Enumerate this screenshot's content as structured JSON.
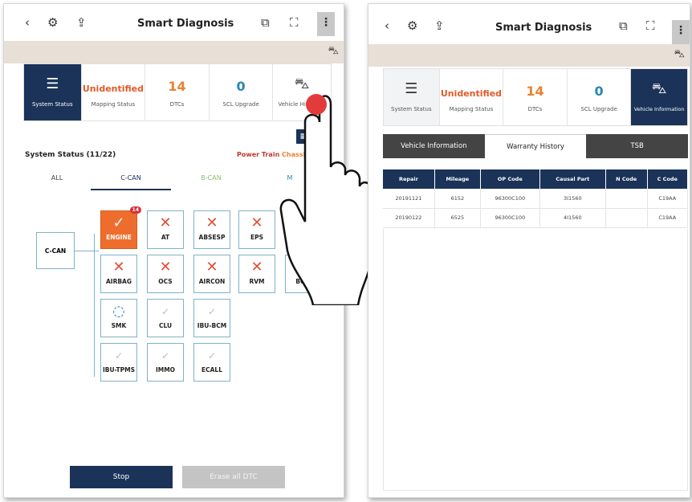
{
  "app": {
    "title": "Smart Diagnosis"
  },
  "status_tiles": {
    "system_status": "System Status",
    "mapping_value": "Unidentified",
    "mapping_label": "Mapping Status",
    "dtc_value": "14",
    "dtc_label": "DTCs",
    "scl_value": "0",
    "scl_label": "SCL Upgrade",
    "vehicle_label_left": "Vehicle Hi",
    "vehicle_label_right": "Vehicle Information"
  },
  "system_section": {
    "title": "System Status (11/22)",
    "filter_power": "Power Train",
    "filter_chassis": "Chassis"
  },
  "bus_tabs": [
    "ALL",
    "C-CAN",
    "B-CAN",
    "M"
  ],
  "bus_root": "C-CAN",
  "modules": [
    {
      "name": "ENGINE",
      "state": "active",
      "badge": "14"
    },
    {
      "name": "AT",
      "state": "error"
    },
    {
      "name": "ABSESP",
      "state": "error"
    },
    {
      "name": "EPS",
      "state": "error"
    },
    {
      "name": "AIRBAG",
      "state": "error"
    },
    {
      "name": "OCS",
      "state": "error"
    },
    {
      "name": "AIRCON",
      "state": "error"
    },
    {
      "name": "RVM",
      "state": "error"
    },
    {
      "name": "BCW",
      "state": "error"
    },
    {
      "name": "SMK",
      "state": "loading"
    },
    {
      "name": "CLU",
      "state": "done"
    },
    {
      "name": "IBU-BCM",
      "state": "done"
    },
    {
      "name": "IBU-TPMS",
      "state": "done"
    },
    {
      "name": "IMMO",
      "state": "done"
    },
    {
      "name": "ECALL",
      "state": "done"
    }
  ],
  "buttons": {
    "stop": "Stop",
    "erase": "Erase all DTC"
  },
  "right_tabs": [
    "Vehicle Information",
    "Warranty History",
    "TSB"
  ],
  "warranty_table": {
    "headers": [
      "Repair",
      "Mileage",
      "OP Code",
      "Causal Part",
      "N Code",
      "C Code"
    ],
    "rows": [
      [
        "20191121",
        "6152",
        "96300C100",
        "3I1560",
        "",
        "C19AA"
      ],
      [
        "20190122",
        "6525",
        "96300C100",
        "4I1560",
        "",
        "C19AA"
      ]
    ]
  },
  "colors": {
    "navy": "#1b3358",
    "orange": "#ef6d2c",
    "error": "#e0503a",
    "beige": "#e8dfd7"
  }
}
